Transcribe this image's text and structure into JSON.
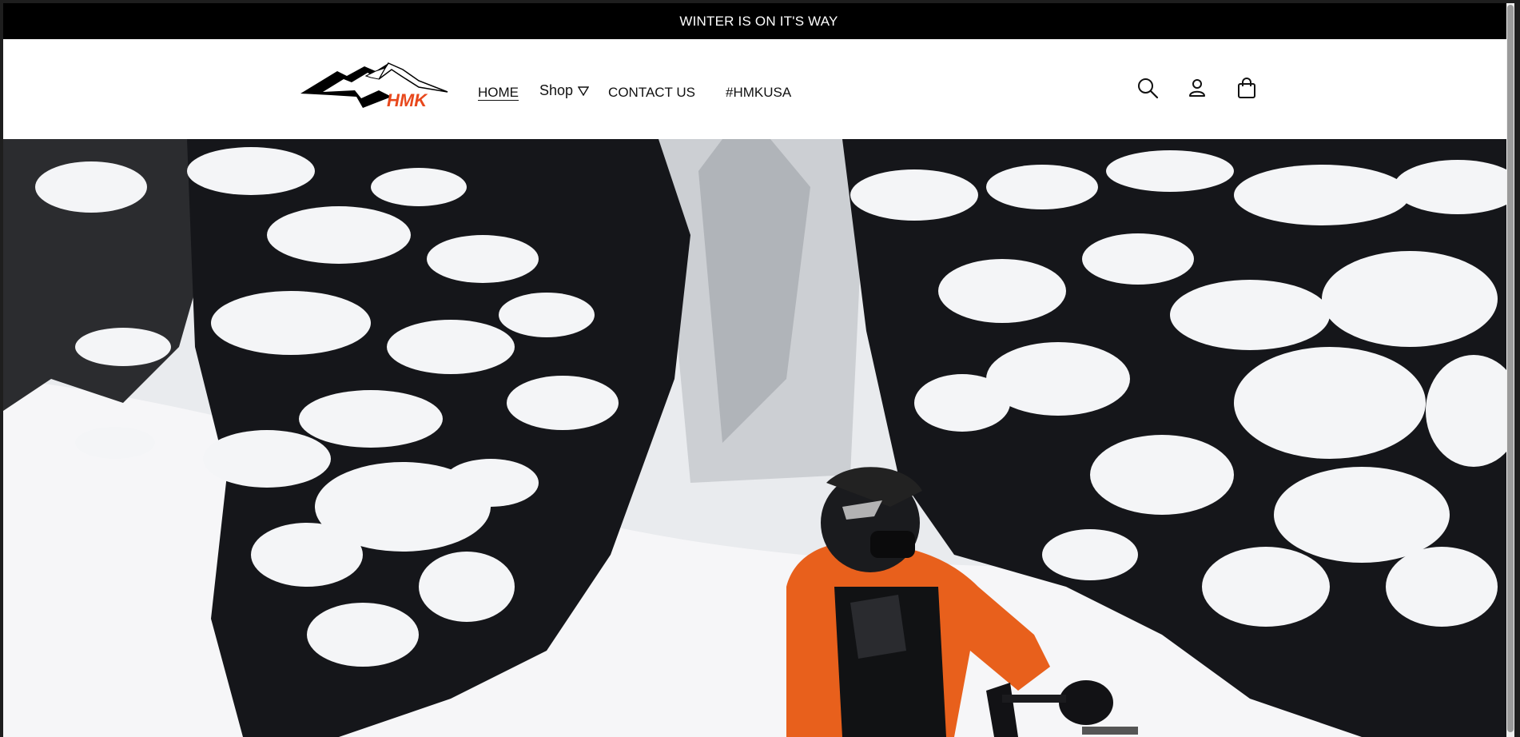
{
  "announcement": {
    "text": "WINTER IS ON IT'S WAY"
  },
  "brand": {
    "logo_text": "HMK",
    "accent_color": "#e8481c"
  },
  "nav": {
    "items": [
      {
        "label": "HOME",
        "active": true
      },
      {
        "label": "Shop",
        "has_dropdown": true
      },
      {
        "label": "CONTACT US"
      },
      {
        "label": "#HMKUSA"
      }
    ]
  },
  "header_icons": [
    "search-icon",
    "account-icon",
    "cart-icon"
  ],
  "hero": {
    "image_subject": "snowmobile rider in orange jacket among snow-covered pine trees"
  },
  "colors": {
    "announcement_bg": "#000000",
    "header_bg": "#ffffff",
    "rider_jacket": "#e8601c"
  }
}
